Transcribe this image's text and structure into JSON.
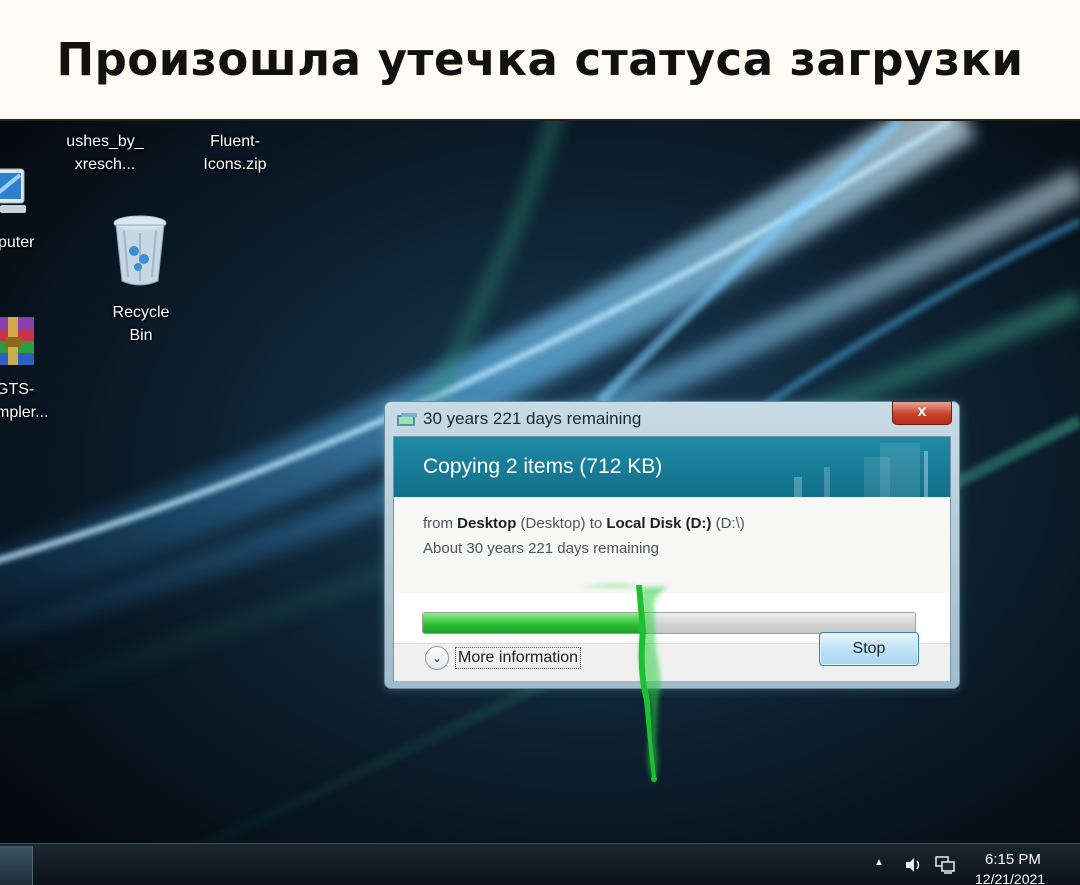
{
  "caption": {
    "text": "Произошла утечка статуса загрузки"
  },
  "desktop": {
    "icons": [
      {
        "line1": "ushes_by_",
        "line2": "xresch..."
      },
      {
        "line1": "Fluent-",
        "line2": "Icons.zip"
      },
      {
        "line1": "puter",
        "line2": ""
      },
      {
        "line1": "Recycle",
        "line2": "Bin"
      },
      {
        "line1": "GTS-",
        "line2": "mpler..."
      }
    ]
  },
  "dialog": {
    "title": "30 years 221 days remaining",
    "close_label": "x",
    "heading": "Copying 2 items (712 KB)",
    "from_prefix": "from ",
    "source_name": "Desktop",
    "source_path": " (Desktop) to ",
    "dest_name": "Local Disk (D:)",
    "dest_path": " (D:\\)",
    "remaining_text": "About 30 years 221 days remaining",
    "progress": 0.45,
    "progress_color": "#2fc23a",
    "more_info_label": "More information",
    "stop_label": "Stop"
  },
  "taskbar": {
    "time": "6:15 PM",
    "date": "12/21/2021",
    "tray_icons": [
      "chevron-up-icon",
      "speaker-icon",
      "network-icon"
    ]
  }
}
